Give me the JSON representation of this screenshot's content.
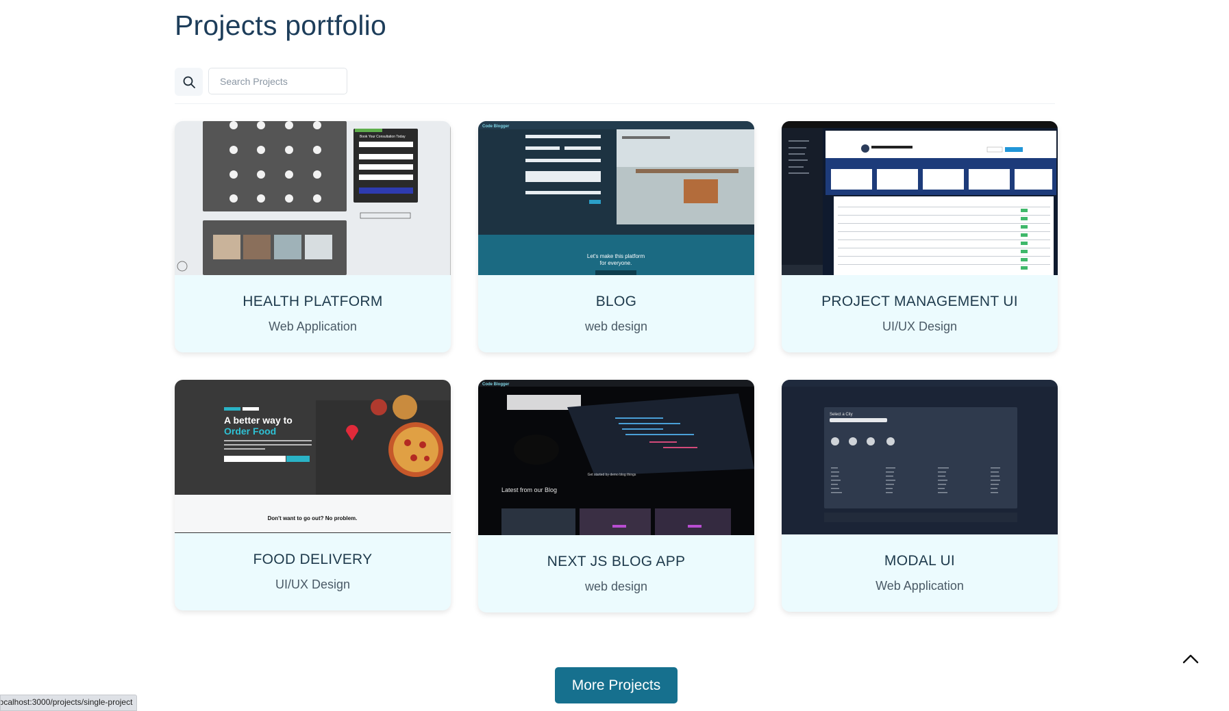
{
  "page": {
    "title": "Projects portfolio"
  },
  "search": {
    "placeholder": "Search Projects",
    "icon": "search-icon"
  },
  "projects": [
    {
      "title": "HEALTH PLATFORM",
      "category": "Web Application",
      "thumbnail": "health-platform-screenshot"
    },
    {
      "title": "BLOG",
      "category": "web design",
      "thumbnail": "blog-screenshot"
    },
    {
      "title": "PROJECT MANAGEMENT UI",
      "category": "UI/UX Design",
      "thumbnail": "project-management-screenshot"
    },
    {
      "title": "FOOD DELIVERY",
      "category": "UI/UX Design",
      "thumbnail": "food-delivery-screenshot",
      "thumb_text": {
        "headline_1": "A better way to",
        "headline_2": "Order Food",
        "footer": "Don't want to go out? No problem."
      }
    },
    {
      "title": "NEXT JS BLOG APP",
      "category": "web design",
      "thumbnail": "nextjs-blog-screenshot",
      "thumb_text": {
        "caption": "Latest from our Blog",
        "sub": "Get started by demo blog things"
      }
    },
    {
      "title": "MODAL UI",
      "category": "Web Application",
      "thumbnail": "modal-ui-screenshot",
      "thumb_text": {
        "heading": "Select a City"
      }
    }
  ],
  "thumb_texts": {
    "health": {
      "form_title": "Book Your Consultation Today"
    },
    "blog": {
      "logo": "Code Blogger",
      "banner_1": "Let's make this platform",
      "banner_2": "for everyone."
    }
  },
  "more_button": {
    "label": "More Projects"
  },
  "status_bar": {
    "url": "localhost:3000/projects/single-project"
  },
  "colors": {
    "accent": "#16708e",
    "card_bg": "#ecfbfe",
    "title": "#1d3d5a"
  }
}
